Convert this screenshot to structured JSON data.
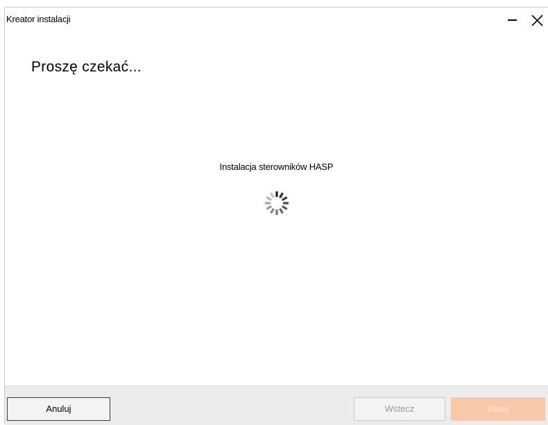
{
  "window": {
    "title": "Kreator instalacji"
  },
  "main": {
    "heading": "Proszę czekać...",
    "status": "Instalacja sterowników HASP"
  },
  "footer": {
    "cancel_label": "Anuluj",
    "back_label": "Wstecz",
    "next_label": "Dalej"
  },
  "colors": {
    "accent_disabled": "#f7c9a8",
    "footer_bg": "#ececec"
  },
  "icons": {
    "minimize": "minimize-icon",
    "close": "close-icon",
    "spinner": "loading-spinner-icon"
  }
}
